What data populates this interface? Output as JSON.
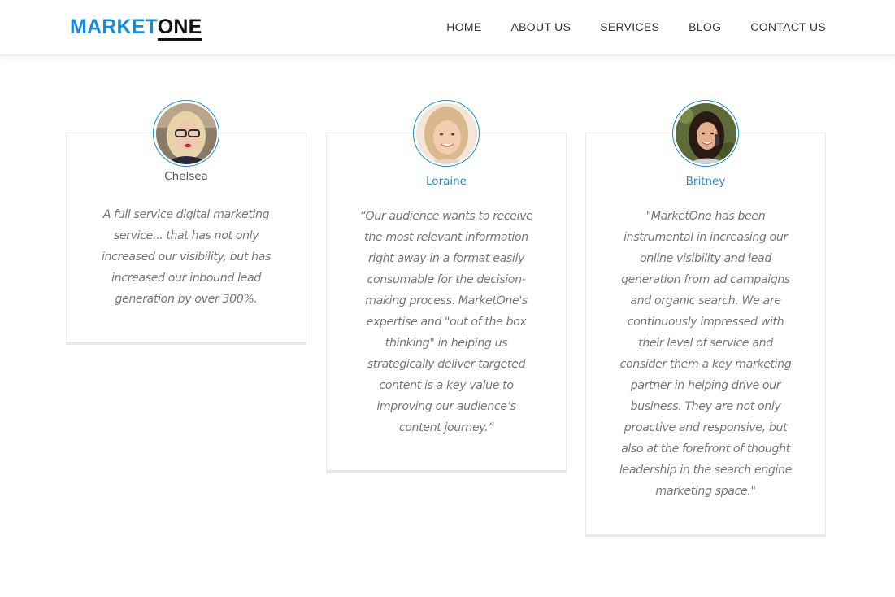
{
  "brand": {
    "part1": "MARKET",
    "part2": "ONE"
  },
  "nav": [
    "HOME",
    "ABOUT US",
    "SERVICES",
    "BLOG",
    "CONTACT US"
  ],
  "testimonials": [
    {
      "name": "Chelsea",
      "quote": "A full service digital marketing service... that has not only increased our visibility, but has increased our inbound lead generation by over 300%."
    },
    {
      "name": "Loraine",
      "quote": "“Our audience wants to receive the most relevant information right away in a format easily consumable for the decision-making process. MarketOne's expertise and \"out of the box thinking\" in helping us strategically deliver targeted content is a key value to improving our audience’s content journey.”"
    },
    {
      "name": "Britney",
      "quote": "\"MarketOne has been instrumental in increasing our online visibility and lead generation from ad campaigns and organic search. We are continuously impressed with their level of service and consider them a key marketing partner in helping drive our business. They are not only proactive and responsive, but also at the forefront of thought leadership in the search engine marketing space.\""
    }
  ],
  "colors": {
    "accent": "#1a8bd4",
    "name_link": "#2f86c8",
    "quote_text": "#777777"
  }
}
